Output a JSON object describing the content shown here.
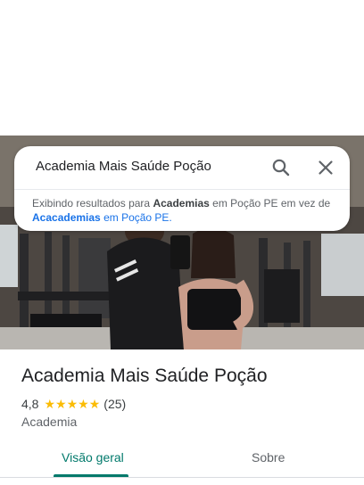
{
  "search": {
    "query": "Academia Mais Saúde Poção"
  },
  "notice": {
    "prefix": "Exibindo resultados para",
    "term_shown": "Academias",
    "middle": "em Poção PE em vez de",
    "term_alt": "Acacademias",
    "suffix": "em Poção PE."
  },
  "place": {
    "name": "Academia Mais Saúde Poção",
    "rating": "4,8",
    "stars": 5,
    "reviews": "(25)",
    "category": "Academia"
  },
  "tabs": [
    {
      "label": "Visão geral",
      "active": true
    },
    {
      "label": "Sobre",
      "active": false
    }
  ],
  "colors": {
    "accent": "#00796b",
    "star": "#fbbc04",
    "link": "#1a73e8"
  },
  "icons": {
    "search": "search-icon",
    "close": "close-icon",
    "star": "star-icon"
  }
}
